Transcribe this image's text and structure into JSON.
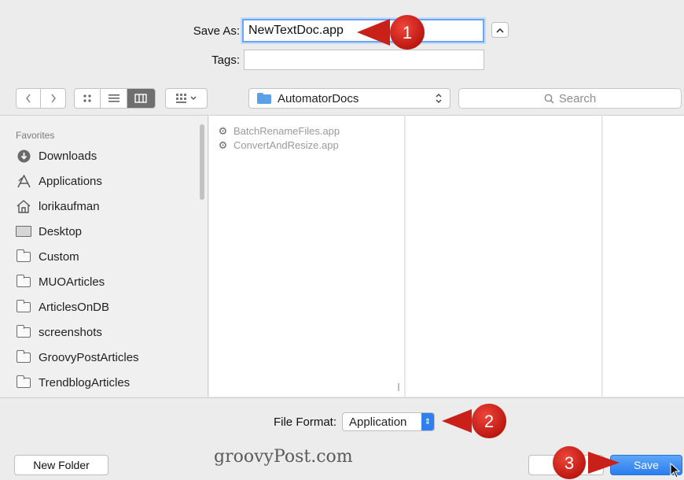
{
  "save_as": {
    "label": "Save As:",
    "value": "NewTextDoc.app"
  },
  "tags": {
    "label": "Tags:",
    "value": ""
  },
  "toolbar": {
    "location": "AutomatorDocs",
    "search_placeholder": "Search"
  },
  "sidebar": {
    "heading": "Favorites",
    "items": [
      {
        "label": "Downloads",
        "icon": "downloads-icon"
      },
      {
        "label": "Applications",
        "icon": "applications-icon"
      },
      {
        "label": "lorikaufman",
        "icon": "home-icon"
      },
      {
        "label": "Desktop",
        "icon": "desktop-icon"
      },
      {
        "label": "Custom",
        "icon": "folder-icon"
      },
      {
        "label": "MUOArticles",
        "icon": "folder-icon"
      },
      {
        "label": "ArticlesOnDB",
        "icon": "folder-icon"
      },
      {
        "label": "screenshots",
        "icon": "folder-icon"
      },
      {
        "label": "GroovyPostArticles",
        "icon": "folder-icon"
      },
      {
        "label": "TrendblogArticles",
        "icon": "folder-icon"
      }
    ]
  },
  "files": [
    {
      "label": "BatchRenameFiles.app",
      "icon": "automator-app-icon"
    },
    {
      "label": "ConvertAndResize.app",
      "icon": "automator-app-icon"
    }
  ],
  "file_format": {
    "label": "File Format:",
    "value": "Application"
  },
  "buttons": {
    "new_folder": "New Folder",
    "save": "Save"
  },
  "watermark": "groovyPost.com",
  "callouts": [
    "1",
    "2",
    "3"
  ],
  "colors": {
    "callout_red": "#d9231d",
    "accent_blue": "#2a7df0"
  }
}
